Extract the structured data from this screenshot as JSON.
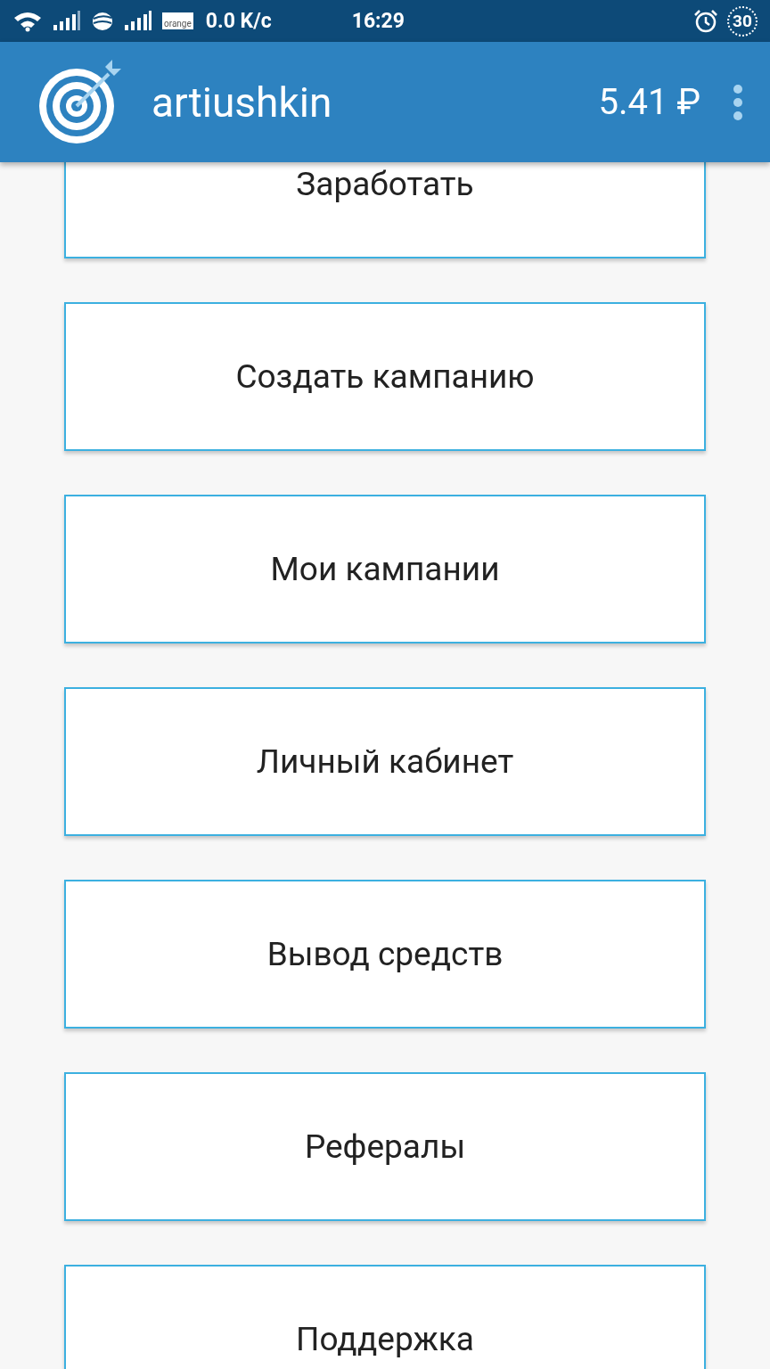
{
  "status_bar": {
    "carrier_label": "orange",
    "speed": "0.0 K/c",
    "time": "16:29",
    "battery": "30"
  },
  "app_bar": {
    "title": "artiushkin",
    "balance": "5.41 ₽"
  },
  "menu": [
    {
      "label": "Заработать"
    },
    {
      "label": "Создать кампанию"
    },
    {
      "label": "Мои кампании"
    },
    {
      "label": "Личный кабинет"
    },
    {
      "label": "Вывод средств"
    },
    {
      "label": "Рефералы"
    },
    {
      "label": "Поддержка"
    }
  ]
}
